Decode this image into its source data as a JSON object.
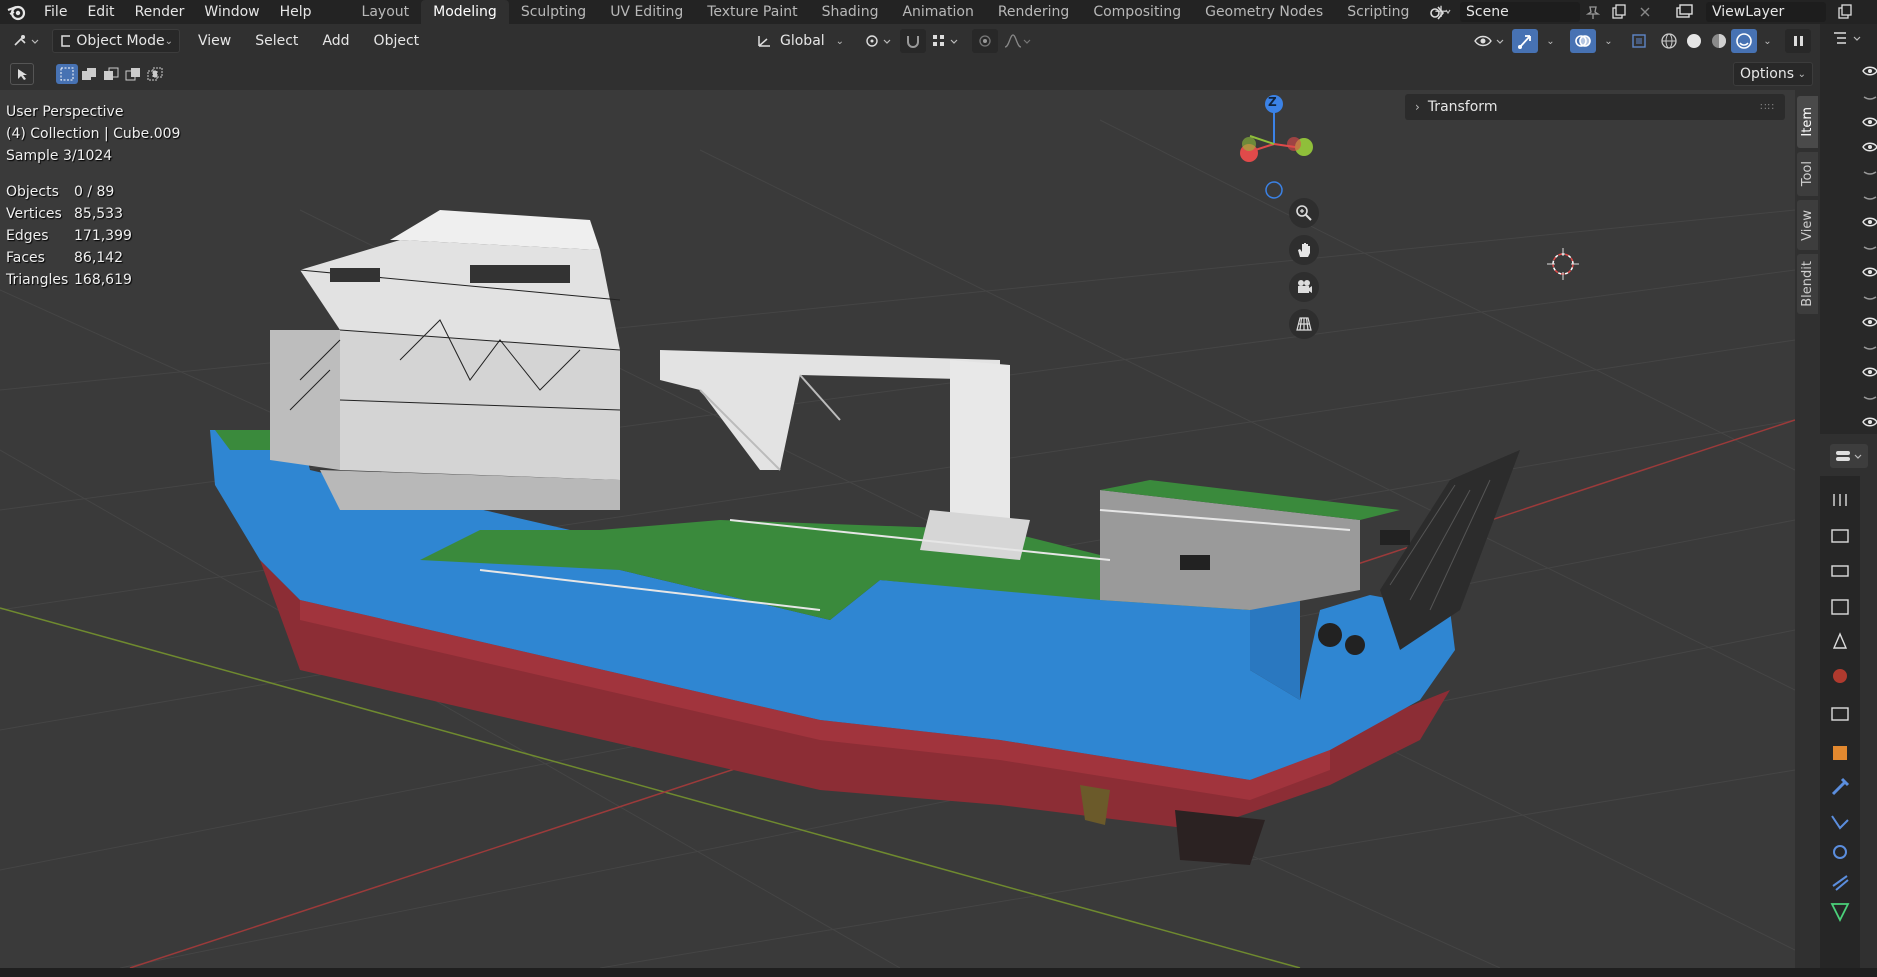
{
  "menu": [
    "File",
    "Edit",
    "Render",
    "Window",
    "Help"
  ],
  "workspaces": [
    {
      "label": "Layout",
      "active": false
    },
    {
      "label": "Modeling",
      "active": true
    },
    {
      "label": "Sculpting",
      "active": false
    },
    {
      "label": "UV Editing",
      "active": false
    },
    {
      "label": "Texture Paint",
      "active": false
    },
    {
      "label": "Shading",
      "active": false
    },
    {
      "label": "Animation",
      "active": false
    },
    {
      "label": "Rendering",
      "active": false
    },
    {
      "label": "Compositing",
      "active": false
    },
    {
      "label": "Geometry Nodes",
      "active": false
    },
    {
      "label": "Scripting",
      "active": false
    }
  ],
  "add_workspace": "+",
  "scene": {
    "name": "Scene"
  },
  "view_layer": {
    "name": "ViewLayer"
  },
  "header": {
    "mode": "Object Mode",
    "menus": [
      "View",
      "Select",
      "Add",
      "Object"
    ],
    "transform_orientation": "Global"
  },
  "tool_settings": {
    "options_label": "Options"
  },
  "viewport": {
    "info_lines": [
      "User Perspective",
      "(4) Collection | Cube.009",
      "Sample 3/1024"
    ],
    "stats": [
      {
        "key": "Objects",
        "value": "0 / 89"
      },
      {
        "key": "Vertices",
        "value": "85,533"
      },
      {
        "key": "Edges",
        "value": "171,399"
      },
      {
        "key": "Faces",
        "value": "86,142"
      },
      {
        "key": "Triangles",
        "value": "168,619"
      }
    ],
    "gizmo_axis_label": "Z"
  },
  "n_panel": {
    "title": "Transform",
    "tabs": [
      "Item",
      "Tool",
      "View",
      "Blendit"
    ]
  },
  "colors": {
    "accent": "#4772b3",
    "hull_blue": "#2f86d2",
    "hull_red": "#8c2d35",
    "deck_green": "#3a8a3c",
    "x_axis": "#e04a4a",
    "y_axis": "#8fbf3a",
    "z_axis": "#3b82e6"
  }
}
